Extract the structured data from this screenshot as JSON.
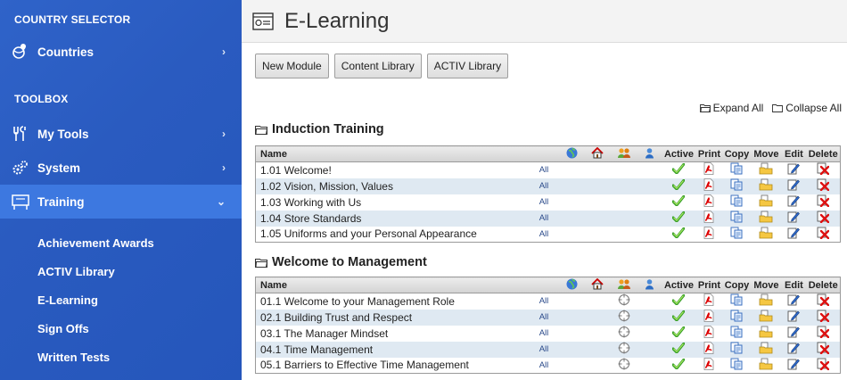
{
  "sidebar": {
    "country_header": "COUNTRY SELECTOR",
    "countries_label": "Countries",
    "toolbox_header": "TOOLBOX",
    "items": [
      {
        "label": "My Tools"
      },
      {
        "label": "System"
      },
      {
        "label": "Training"
      }
    ],
    "training_sub": [
      {
        "label": "Achievement Awards"
      },
      {
        "label": "ACTIV Library"
      },
      {
        "label": "E-Learning"
      },
      {
        "label": "Sign Offs"
      },
      {
        "label": "Written Tests"
      }
    ]
  },
  "header": {
    "title": "E-Learning"
  },
  "toolbar": {
    "new_module": "New Module",
    "content_library": "Content Library",
    "activ_library": "ACTIV Library",
    "expand_all": "Expand All",
    "collapse_all": "Collapse All"
  },
  "columns": {
    "name": "Name",
    "active": "Active",
    "print": "Print",
    "copy": "Copy",
    "move": "Move",
    "edit": "Edit",
    "delete": "Delete"
  },
  "groups": [
    {
      "title": "Induction Training",
      "rows": [
        {
          "name": "1.01 Welcome!",
          "audience": "All"
        },
        {
          "name": "1.02 Vision, Mission, Values",
          "audience": "All"
        },
        {
          "name": "1.03 Working with Us",
          "audience": "All"
        },
        {
          "name": "1.04 Store Standards",
          "audience": "All"
        },
        {
          "name": "1.05 Uniforms and your Personal Appearance",
          "audience": "All"
        }
      ]
    },
    {
      "title": "Welcome to Management",
      "rows": [
        {
          "name": "01.1 Welcome to your Management Role",
          "audience": "All"
        },
        {
          "name": "02.1 Building Trust and Respect",
          "audience": "All"
        },
        {
          "name": "03.1 The Manager Mindset",
          "audience": "All"
        },
        {
          "name": "04.1 Time Management",
          "audience": "All"
        },
        {
          "name": "05.1 Barriers to Effective Time Management",
          "audience": "All"
        }
      ]
    }
  ]
}
